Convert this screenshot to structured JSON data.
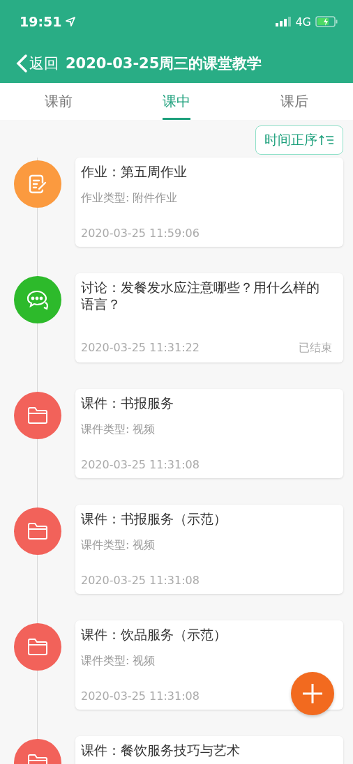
{
  "status_bar": {
    "time": "19:51",
    "network": "4G"
  },
  "header": {
    "back_label": "返回",
    "title": "2020-03-25周三的课堂教学"
  },
  "tabs": [
    {
      "label": "课前",
      "selected": false
    },
    {
      "label": "课中",
      "selected": true
    },
    {
      "label": "课后",
      "selected": false
    }
  ],
  "sort_button": {
    "label": "时间正序"
  },
  "items": [
    {
      "kind": "homework",
      "title": "作业：第五周作业",
      "subtitle": "作业类型: 附件作业",
      "time": "2020-03-25 11:59:06"
    },
    {
      "kind": "discussion",
      "title": "讨论：发餐发水应注意哪些？用什么样的语言？",
      "time": "2020-03-25 11:31:22",
      "status": "已结束"
    },
    {
      "kind": "courseware",
      "title": "课件：书报服务",
      "subtitle": "课件类型: 视频",
      "time": "2020-03-25 11:31:08"
    },
    {
      "kind": "courseware",
      "title": "课件：书报服务（示范）",
      "subtitle": "课件类型: 视频",
      "time": "2020-03-25 11:31:08"
    },
    {
      "kind": "courseware",
      "title": "课件：饮品服务（示范）",
      "subtitle": "课件类型: 视频",
      "time": "2020-03-25 11:31:08"
    },
    {
      "kind": "courseware",
      "title": "课件：餐饮服务技巧与艺术"
    }
  ]
}
